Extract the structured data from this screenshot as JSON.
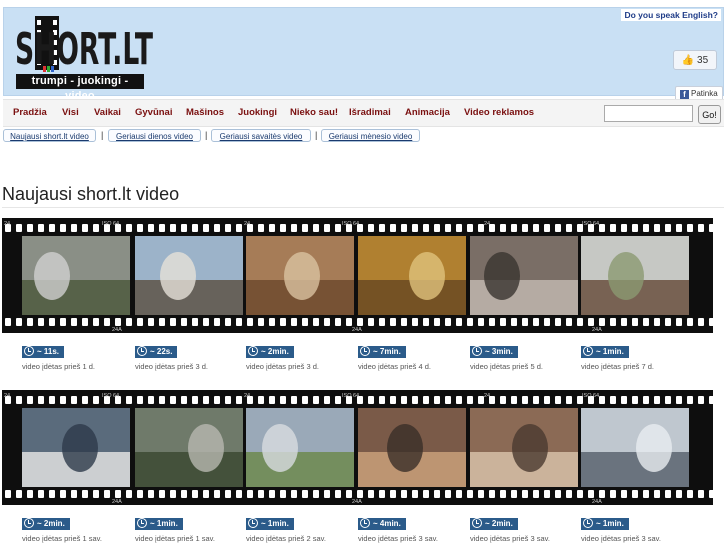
{
  "header": {
    "logo_text": "SHORT.LT",
    "slogan": "trumpi - juokingi - video",
    "language_link": "Do you speak English?",
    "like_count": "35",
    "share_label": "Patinka"
  },
  "nav": {
    "items": [
      "Pradžia",
      "Visi",
      "Vaikai",
      "Gyvūnai",
      "Mašinos",
      "Juokingi",
      "Nieko sau!",
      "Išradimai",
      "Animacija",
      "Video reklamos"
    ],
    "search_value": "",
    "go_label": "Go!"
  },
  "subnav": {
    "items": [
      "Naujausi short.lt video",
      "Geriausi dienos video",
      "Geriausi savaitės video",
      "Geriausi mėnesio video"
    ],
    "separator": "|"
  },
  "section": {
    "title": "Naujausi short.lt video"
  },
  "filmstrip": {
    "frame_labels": [
      "24",
      "ISO 64",
      "24A"
    ]
  },
  "rows": [
    {
      "videos": [
        {
          "duration": "~ 11s.",
          "posted": "video įdėtas prieš 1 d."
        },
        {
          "duration": "~ 22s.",
          "posted": "video įdėtas prieš 3 d."
        },
        {
          "duration": "~ 2min.",
          "posted": "video įdėtas prieš 3 d."
        },
        {
          "duration": "~ 7min.",
          "posted": "video įdėtas prieš 4 d."
        },
        {
          "duration": "~ 3min.",
          "posted": "video įdėtas prieš 5 d."
        },
        {
          "duration": "~ 1min.",
          "posted": "video įdėtas prieš 7 d."
        }
      ]
    },
    {
      "videos": [
        {
          "duration": "~ 2min.",
          "posted": "video įdėtas prieš 1 sav."
        },
        {
          "duration": "~ 1min.",
          "posted": "video įdėtas prieš 1 sav."
        },
        {
          "duration": "~ 1min.",
          "posted": "video įdėtas prieš 2 sav."
        },
        {
          "duration": "~ 4min.",
          "posted": "video įdėtas prieš 3 sav."
        },
        {
          "duration": "~ 2min.",
          "posted": "video įdėtas prieš 3 sav."
        },
        {
          "duration": "~ 1min.",
          "posted": "video įdėtas prieš 3 sav."
        }
      ]
    }
  ],
  "colors": {
    "header_bg": "#c9e0f4",
    "nav_text": "#7a1010",
    "duration_badge": "#2b5b8a",
    "subnav_text": "#1a3a6e"
  }
}
